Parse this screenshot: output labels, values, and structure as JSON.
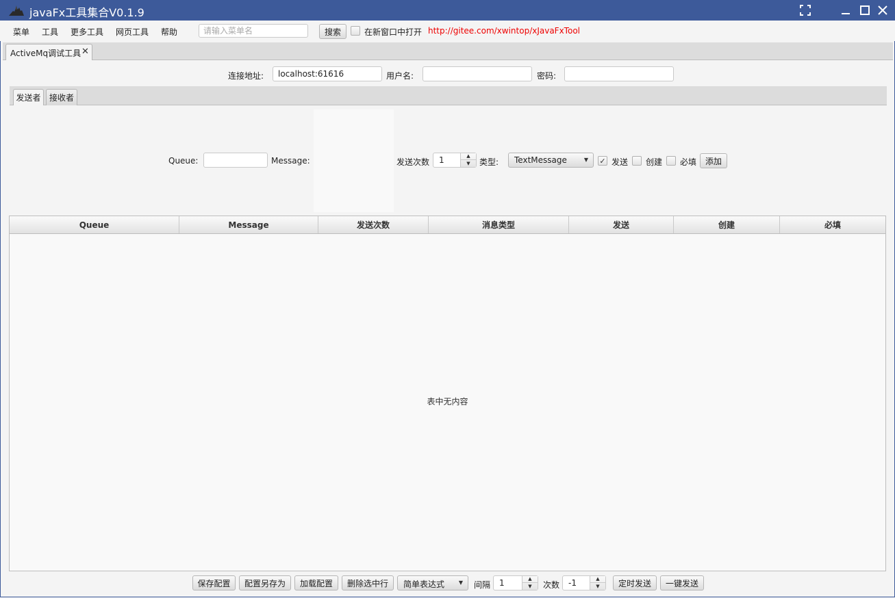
{
  "window": {
    "title": "javaFx工具集合V0.1.9",
    "accent_color": "#3d5a9a",
    "controls": [
      "fullscreen-icon",
      "minimize-icon",
      "maximize-icon",
      "close-icon"
    ]
  },
  "menubar": {
    "items": [
      "菜单",
      "工具",
      "更多工具",
      "网页工具",
      "帮助"
    ],
    "search_placeholder": "请输入菜单名",
    "search_value": "",
    "search_button": "搜索",
    "new_window_label": "在新窗口中打开",
    "new_window_checked": false,
    "link": "http://gitee.com/xwintop/xJavaFxTool",
    "link_color": "#e00000"
  },
  "main_tab": {
    "label": "ActiveMq调试工具",
    "close": "✕"
  },
  "connection": {
    "url_label": "连接地址:",
    "url_value": "localhost:61616",
    "username_label": "用户名:",
    "username_value": "",
    "password_label": "密码:",
    "password_value": ""
  },
  "sub_tabs": [
    "发送者",
    "接收者"
  ],
  "sender": {
    "queue_label": "Queue:",
    "queue_value": "",
    "message_label": "Message:",
    "message_value": "",
    "send_count_label": "发送次数",
    "send_count_value": "1",
    "type_label": "类型:",
    "type_value": "TextMessage",
    "send_label": "发送",
    "send_checked": true,
    "create_label": "创建",
    "create_checked": false,
    "required_label": "必填",
    "required_checked": false,
    "add_button": "添加"
  },
  "table": {
    "columns": [
      "Queue",
      "Message",
      "发送次数",
      "消息类型",
      "发送",
      "创建",
      "必填"
    ],
    "rows": [],
    "empty_text": "表中无内容"
  },
  "bottom": {
    "save_config": "保存配置",
    "save_config_as": "配置另存为",
    "load_config": "加载配置",
    "delete_selected": "删除选中行",
    "expression_value": "简单表达式",
    "interval_label": "间隔",
    "interval_value": "1",
    "count_label": "次数",
    "count_value": "-1",
    "timed_send": "定时发送",
    "one_click_send": "一键发送"
  }
}
